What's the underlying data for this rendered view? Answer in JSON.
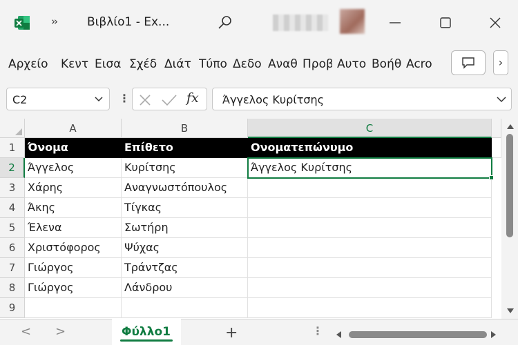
{
  "window": {
    "title": "Βιβλίο1  -  Ex...",
    "chevrons": "››"
  },
  "ribbon": {
    "tabs": [
      "Αρχείο",
      "Κεντ",
      "Εισα",
      "Σχέδ",
      "Διάτ",
      "Τύπο",
      "Δεδο",
      "Αναθ",
      "Προβ",
      "Αυτο",
      "Βοήθ",
      "Acro"
    ],
    "more": "›"
  },
  "formula_bar": {
    "name_box": "C2",
    "kebab": "⋮",
    "formula": "Άγγελος Κυρίτσης"
  },
  "columns": [
    "A",
    "B",
    "C"
  ],
  "rows": [
    "1",
    "2",
    "3",
    "4",
    "5",
    "6",
    "7",
    "8",
    "9"
  ],
  "cells": {
    "header": [
      "Όνομα",
      "Επίθετο",
      "Ονοματεπώνυμο"
    ],
    "data": [
      [
        "Άγγελος",
        "Κυρίτσης",
        "Άγγελος Κυρίτσης"
      ],
      [
        "Χάρης",
        "Αναγνωστόπουλος",
        ""
      ],
      [
        "Άκης",
        "Τίγκας",
        ""
      ],
      [
        "Έλενα",
        "Σωτήρη",
        ""
      ],
      [
        "Χριστόφορος",
        "Ψύχας",
        ""
      ],
      [
        "Γιώργος",
        "Τράντζας",
        ""
      ],
      [
        "Γιώργος",
        "Λάνδρου",
        ""
      ]
    ]
  },
  "sheets": {
    "active": "Φύλλο1",
    "add": "+",
    "prev": "<",
    "next": ">"
  },
  "colors": {
    "accent": "#107c41",
    "header_fill": "#000000"
  }
}
